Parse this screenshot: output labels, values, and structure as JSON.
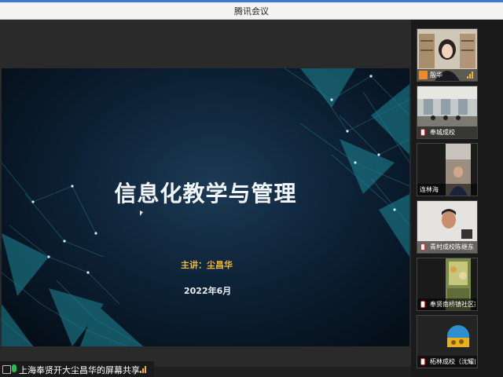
{
  "window": {
    "title": "腾讯会议"
  },
  "slide": {
    "title": "信息化教学与管理",
    "speaker": "主讲：尘昌华",
    "date": "2022年6月"
  },
  "status": {
    "share_text": "上海奉贤开大尘昌华的屏幕共享"
  },
  "participants": [
    {
      "name": "殷华",
      "host": true
    },
    {
      "name": "奉城成校",
      "host": false
    },
    {
      "name": "连林海",
      "host": false
    },
    {
      "name": "青村成校陈继东",
      "host": false
    },
    {
      "name": "奉贤南桥镇社区家长学...",
      "host": false
    },
    {
      "name": "柘林成校（沈耀良）",
      "host": false
    }
  ],
  "colors": {
    "accent": "#f0b731",
    "mic_ok": "#23c05a",
    "host_badge": "#f08a24"
  }
}
